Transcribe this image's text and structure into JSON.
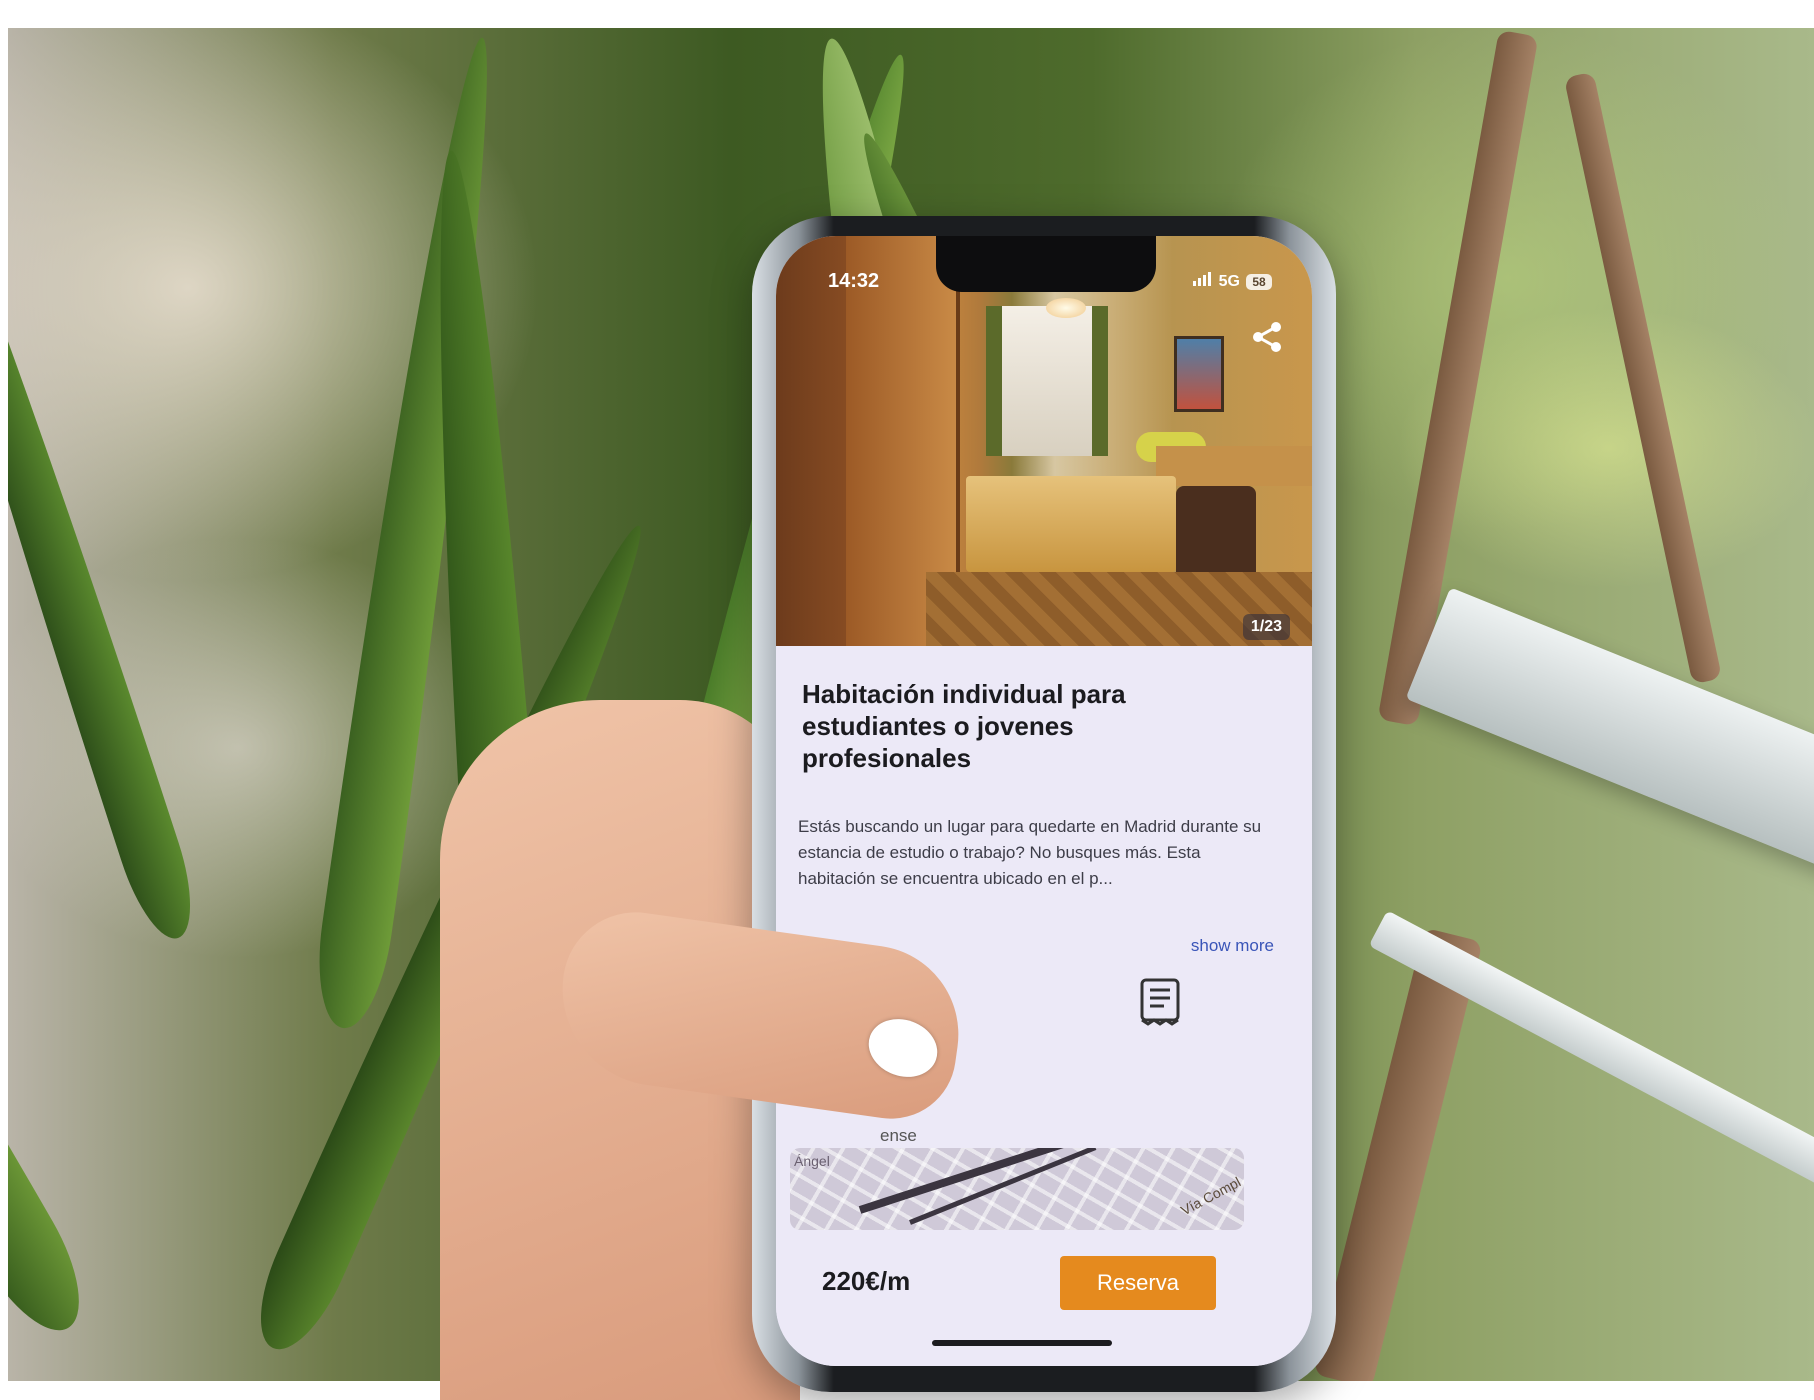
{
  "status_bar": {
    "time": "14:32",
    "network": "5G",
    "battery": "58"
  },
  "listing": {
    "photo_counter": "1/23",
    "title": "Habitación individual para estudiantes o jovenes profesionales",
    "description": "Estás buscando un lugar para quedarte en Madrid durante su estancia de estudio o trabajo? No busques más. Esta habitación se encuentra ubicado en el p...",
    "show_more": "show more",
    "amenities": [
      "wifi-icon",
      "document-icon"
    ],
    "map_partial_label": "ense",
    "map_place_label": "Ángel",
    "map_street_label": "Vía Compl",
    "price": "220€/m",
    "reserve_label": "Reserva"
  },
  "colors": {
    "accent": "#e58a1e",
    "link": "#3a55b8",
    "card_background": "#ece9f7"
  }
}
